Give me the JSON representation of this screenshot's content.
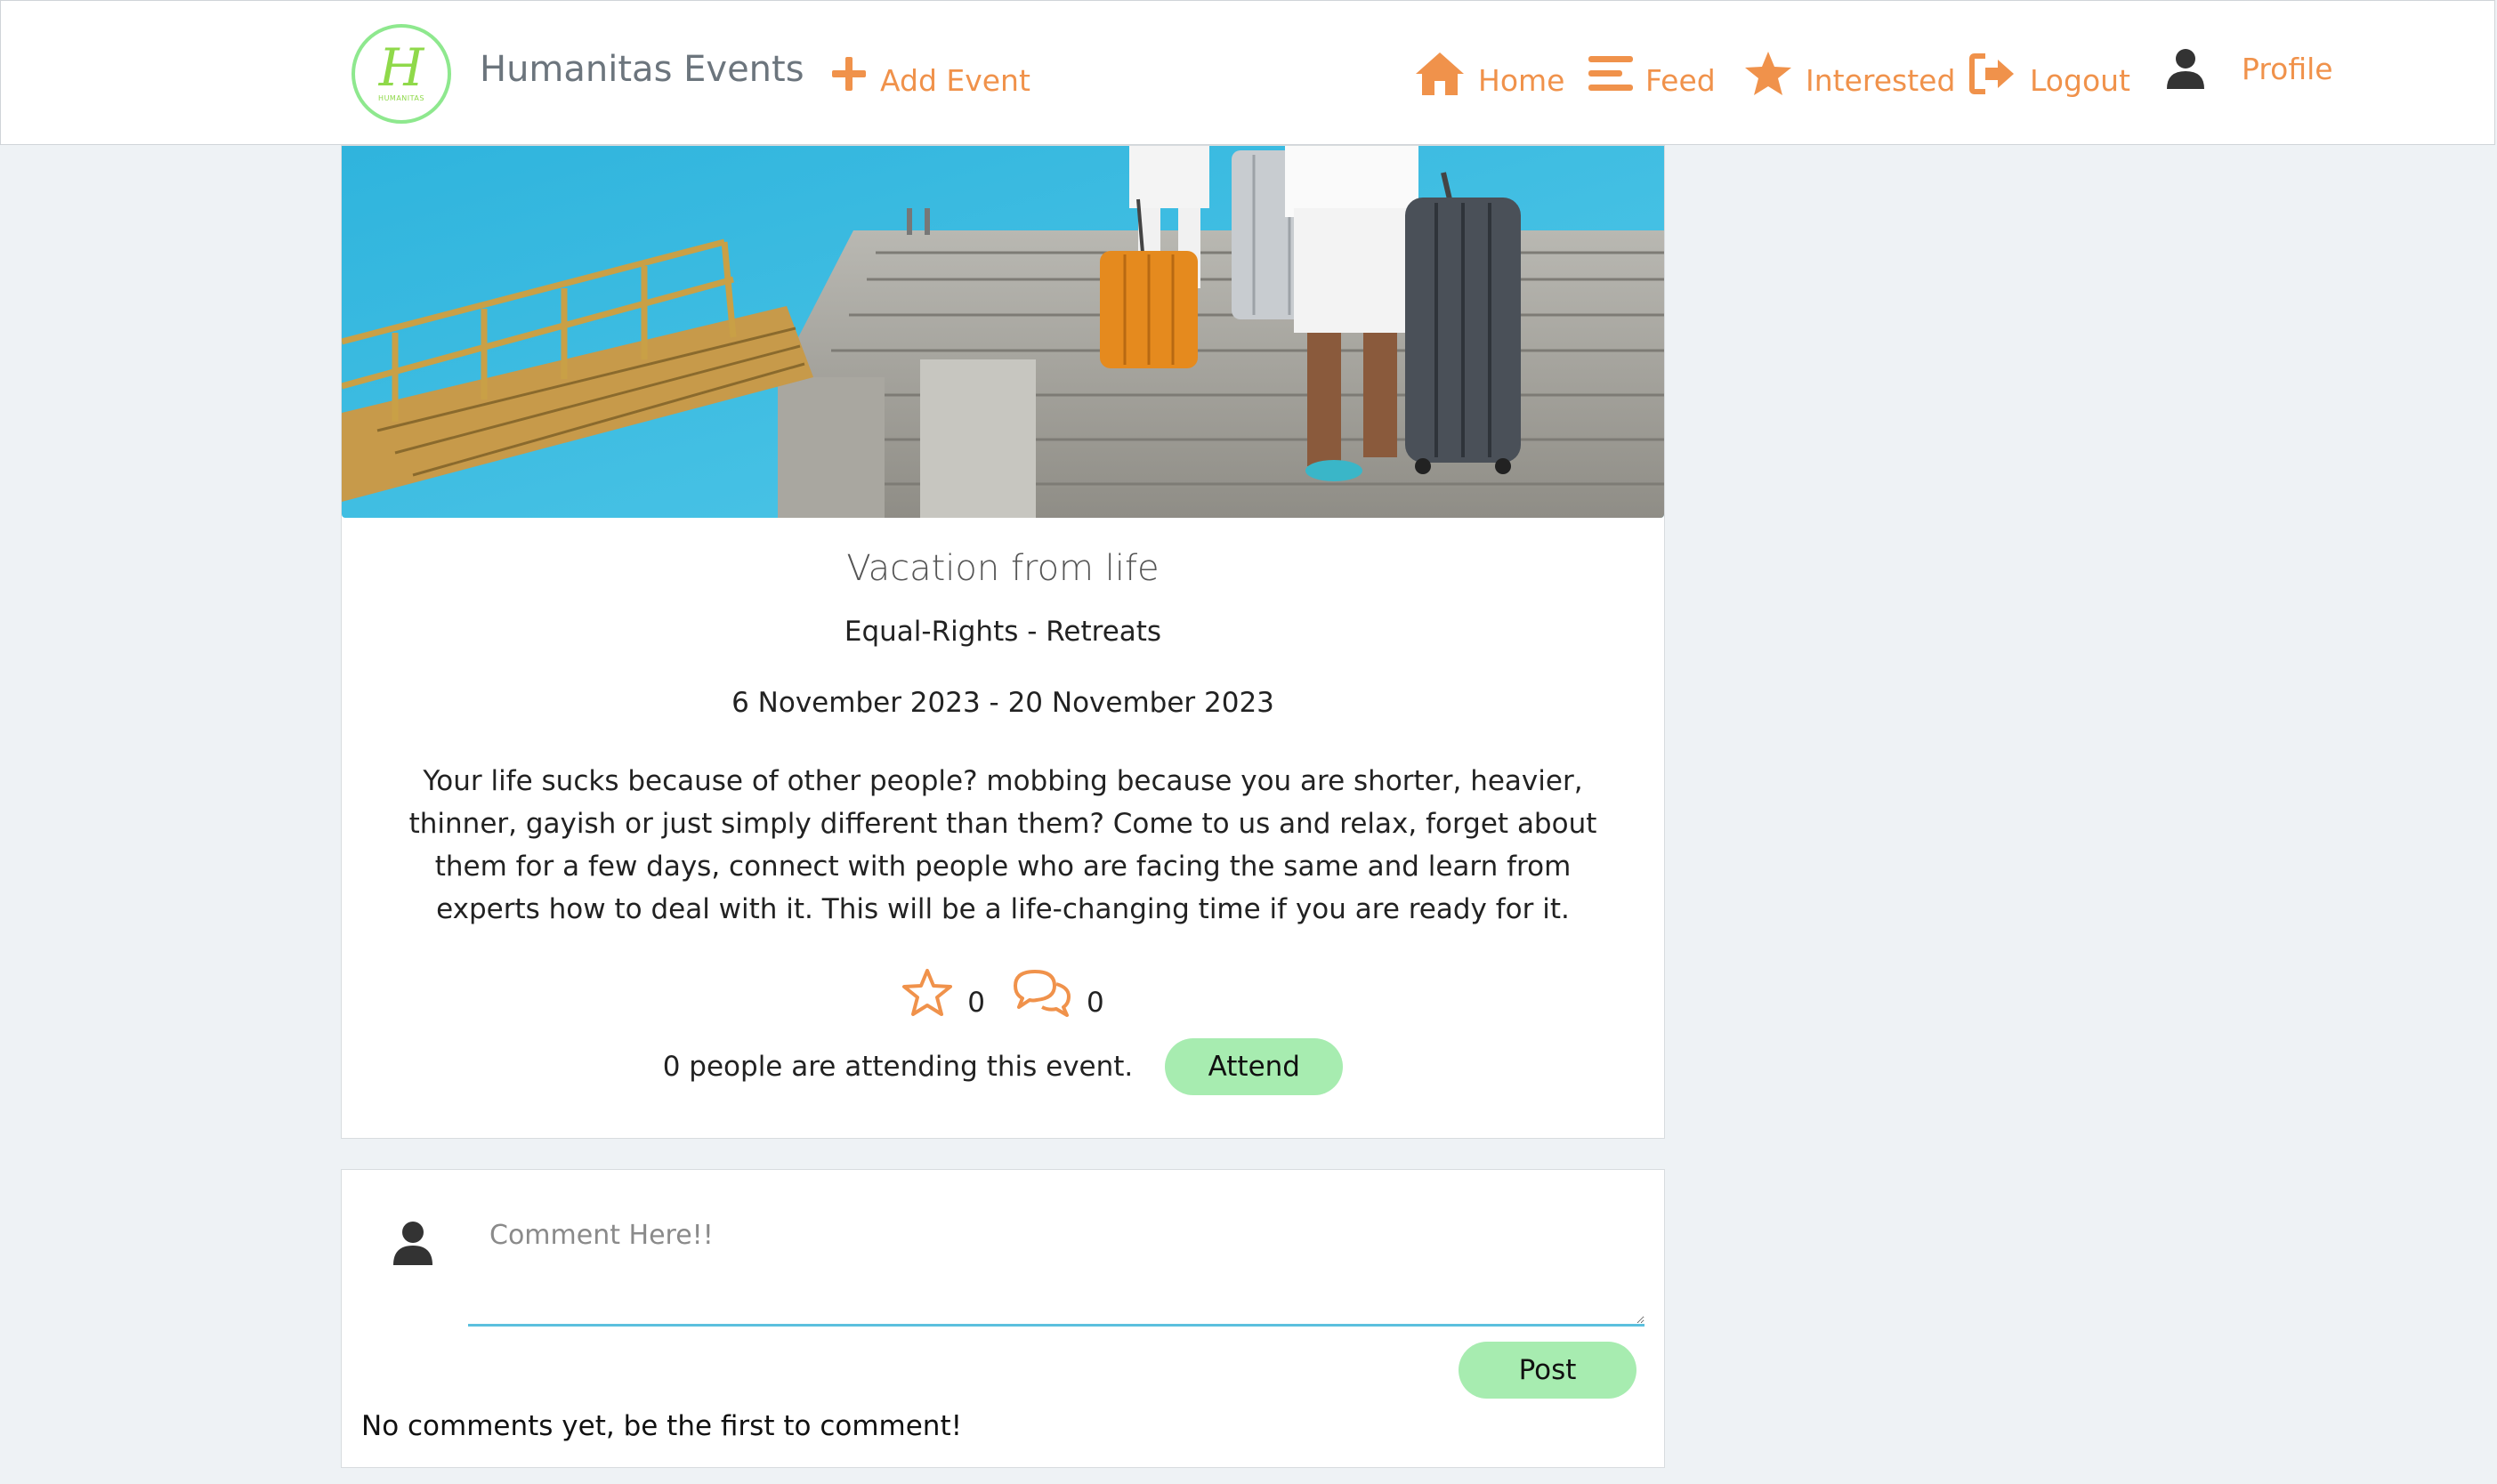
{
  "navbar": {
    "logo_letter": "H",
    "logo_tagline": "HUMANITAS",
    "brand": "Humanitas Events",
    "add_event": "Add Event",
    "home": "Home",
    "feed": "Feed",
    "interested": "Interested",
    "logout": "Logout",
    "profile": "Profile",
    "accent_color": "#f0924b"
  },
  "event": {
    "image_alt": "Two people pulling suitcases along a wooden pier by turquoise water",
    "title": "Vacation from life",
    "categories": "Equal-Rights - Retreats",
    "dates": "6 November 2023 - 20 November 2023",
    "description": "Your life sucks because of other people? mobbing because you are shorter, heavier, thinner, gayish or just simply different than them? Come to us and relax, forget about them for a few days, connect with people who are facing the same and learn from experts how to deal with it. This will be a life-changing time if you are ready for it.",
    "interested_count": "0",
    "comment_count": "0",
    "attending_text": "0 people are attending this event.",
    "attend_label": "Attend"
  },
  "comments": {
    "placeholder": "Comment Here!!",
    "post_label": "Post",
    "empty_text": "No comments yet, be the first to comment!"
  }
}
